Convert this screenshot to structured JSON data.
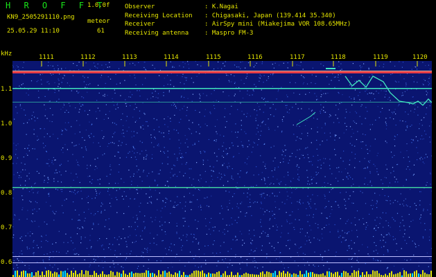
{
  "app": {
    "title": "H R O F F T",
    "version": "1.0.0f",
    "filename": "KN9_2505291110.png",
    "meteor_label": "meteor",
    "meteor_count": "61",
    "timestamp": "25.05.29 11:10"
  },
  "station_info": [
    {
      "label": "Observer",
      "value": ": K.Nagai"
    },
    {
      "label": "Receiving Location",
      "value": ": Chigasaki, Japan (139.414 35.340)"
    },
    {
      "label": "Receiver",
      "value": ": AirSpy mini (Miakejima VOR 108.65MHz)"
    },
    {
      "label": "Receiving antenna",
      "value": ": Maspro FM-3"
    }
  ],
  "axis": {
    "y_unit": "kHz",
    "y_ticks": [
      "1.1",
      "1.0",
      "0.9",
      "0.8",
      "0.7",
      "0.6"
    ],
    "x_ticks": [
      "1111",
      "1112",
      "1113",
      "1114",
      "1115",
      "1116",
      "1117",
      "1118",
      "1119",
      "1120"
    ]
  },
  "colors": {
    "text": "#e6e600",
    "title": "#19e619",
    "background": "#0a1570",
    "signal": "#ff4040"
  }
}
